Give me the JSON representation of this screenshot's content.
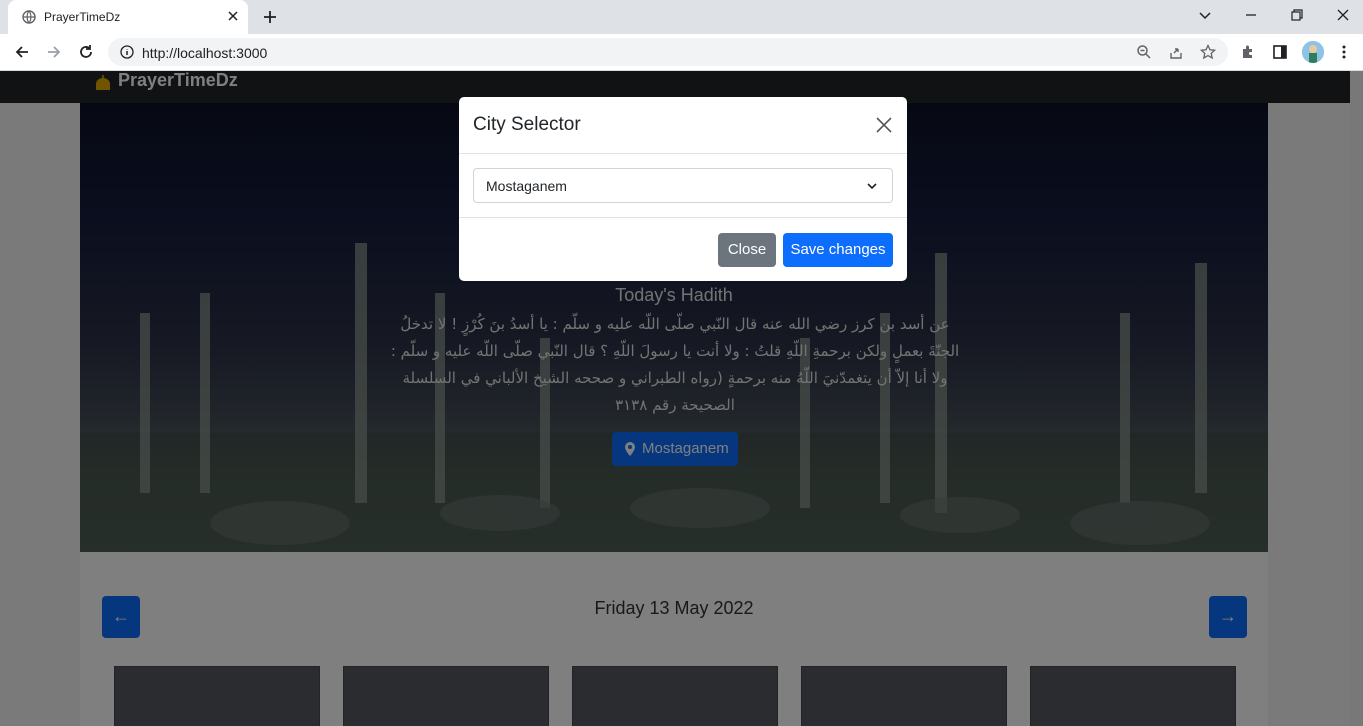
{
  "browser": {
    "tab_title": "PrayerTimeDz",
    "url": "http://localhost:3000"
  },
  "navbar": {
    "brand": "PrayerTimeDz"
  },
  "hero": {
    "hadith_title": "Today's Hadith",
    "hadith_text": "عن أسد بن كرز رضي الله عنه قال النّبي صلّى اللّه عليه و سلّم : يا أسدُ بنَ كُرْزٍ ! لا تدخلُ الجنّةَ بعملٍ ولكن برحمةِ اللّهِ قلتُ : ولا أنت يا رسولَ اللّهِ ؟ قال النّبي صلّى اللّه عليه و سلّم : ولا أنا إلاّ أن يتغمدّنيَ اللّهُ منه برحمةٍ (رواه الطبراني و صححه الشيخ الألباني في السلسلة الصحيحة رقم ٣١٣٨",
    "city_button_label": "Mostaganem"
  },
  "prayer_section": {
    "prev_arrow": "←",
    "next_arrow": "→",
    "date": "Friday 13 May 2022"
  },
  "modal": {
    "title": "City Selector",
    "selected_city": "Mostaganem",
    "close_label": "Close",
    "save_label": "Save changes"
  },
  "colors": {
    "primary": "#0d6efd",
    "secondary": "#6c757d",
    "navbar": "#212529"
  }
}
